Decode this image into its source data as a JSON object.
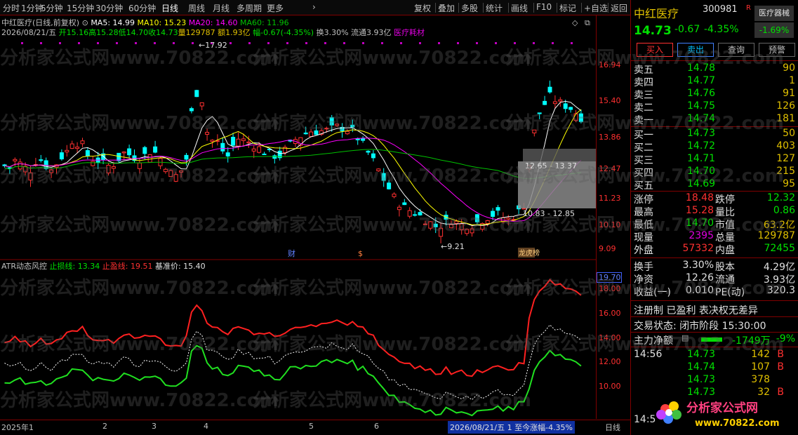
{
  "toolbar": {
    "left": [
      "分时",
      "1分钟",
      "5分钟",
      "15分钟",
      "30分钟",
      "60分钟",
      "日线",
      "周线",
      "月线",
      "多周期",
      "更多"
    ],
    "right": [
      "复权",
      "叠加",
      "多股",
      "统计",
      "画线",
      "F10",
      "标记",
      "+自选",
      "返回"
    ],
    "active": "日线"
  },
  "chart_info": {
    "title": "中红医疗(日线,前复权)",
    "ma5": "MA5: 14.99",
    "ma10": "MA10: 15.23",
    "ma20": "MA20: 14.60",
    "ma60": "MA60: 11.96",
    "date": "2026/08/21/五",
    "open": "开15.16",
    "high": "高15.28",
    "low": "低14.70",
    "close": "收14.73",
    "vol": "量129787",
    "amt": "额1.93亿",
    "chg": "幅-0.67(-4.35%)",
    "turnover": "换3.30%",
    "float": "流通3.93亿",
    "sector": "医疗耗材"
  },
  "annotations": {
    "peak": "17.92",
    "trough": "9.21",
    "box_top": "12.65 - 13.37",
    "box_bot": "10.83 - 12.85",
    "cai": "财",
    "s": "$",
    "xl": "龙虎榜"
  },
  "price_axis": [
    "16.94",
    "15.40",
    "13.86",
    "12.47",
    "11.23",
    "10.10",
    "9.09"
  ],
  "atr": {
    "name": "ATR动态风控",
    "stop_loss": "止损线: 13.34",
    "take_profit": "止盈线: 19.51",
    "base": "基准价: 15.40",
    "current": "19.70",
    "axis": [
      "18.00",
      "16.00",
      "14.00",
      "12.00",
      "10.00"
    ]
  },
  "x_axis": {
    "labels": [
      "2025年1",
      "2",
      "3",
      "4",
      "5",
      "6"
    ],
    "status": "2026/08/21/五 1 至今涨幅-4.35%",
    "period": "日线"
  },
  "quote": {
    "name": "中红医疗",
    "code": "300981",
    "flag": "R",
    "sector_btn": "医疗器械",
    "price": "14.73",
    "chg": "-0.67",
    "pct": "-4.35%",
    "sector_pct": "-1.69%",
    "buttons": [
      "买入",
      "卖出",
      "查询",
      "预警"
    ],
    "asks": [
      [
        "卖五",
        "14.78",
        "90"
      ],
      [
        "卖四",
        "14.77",
        "1"
      ],
      [
        "卖三",
        "14.76",
        "91"
      ],
      [
        "卖二",
        "14.75",
        "126"
      ],
      [
        "卖一",
        "14.74",
        "181"
      ]
    ],
    "bids": [
      [
        "买一",
        "14.73",
        "50"
      ],
      [
        "买二",
        "14.72",
        "403"
      ],
      [
        "买三",
        "14.71",
        "127"
      ],
      [
        "买四",
        "14.70",
        "215"
      ],
      [
        "买五",
        "14.69",
        "95"
      ]
    ],
    "stats": [
      [
        "涨停",
        "18.48",
        "跌停",
        "12.32"
      ],
      [
        "最高",
        "15.28",
        "量比",
        "0.86"
      ],
      [
        "最低",
        "14.70",
        "市值",
        "63.2亿"
      ],
      [
        "现量",
        "2395",
        "总量",
        "129787"
      ],
      [
        "外盘",
        "57332",
        "内盘",
        "72455"
      ]
    ],
    "stats2": [
      [
        "换手",
        "3.30%",
        "股本",
        "4.29亿"
      ],
      [
        "净资",
        "12.26",
        "流通",
        "3.93亿"
      ],
      [
        "收益(一)",
        "0.010",
        "PE(动)",
        "320.3"
      ]
    ],
    "tags": "注册制 已盈利 表决权无差异",
    "trade_status": "交易状态: 闭市阶段 15:30:00",
    "net_flow_label": "主力净额",
    "net_flow": "-1749万",
    "net_flow_pct": "-9%",
    "ticks_time": "14:56",
    "ticks": [
      [
        "14.73",
        "142",
        "B"
      ],
      [
        "14.74",
        "107",
        "B"
      ],
      [
        "14.73",
        "378",
        ""
      ],
      [
        "14.73",
        "32",
        "B"
      ]
    ],
    "tick_time_bottom": "14:5"
  },
  "watermark": "分析家公式网www.70822.com",
  "logo_text": "分析家公式网",
  "logo_url": "www.70822.com",
  "colors": {
    "up": "#ff3030",
    "down": "#00ffff",
    "ma5": "#ffffff",
    "ma10": "#ffff00",
    "ma20": "#ff00ff",
    "ma60": "#00c000"
  }
}
